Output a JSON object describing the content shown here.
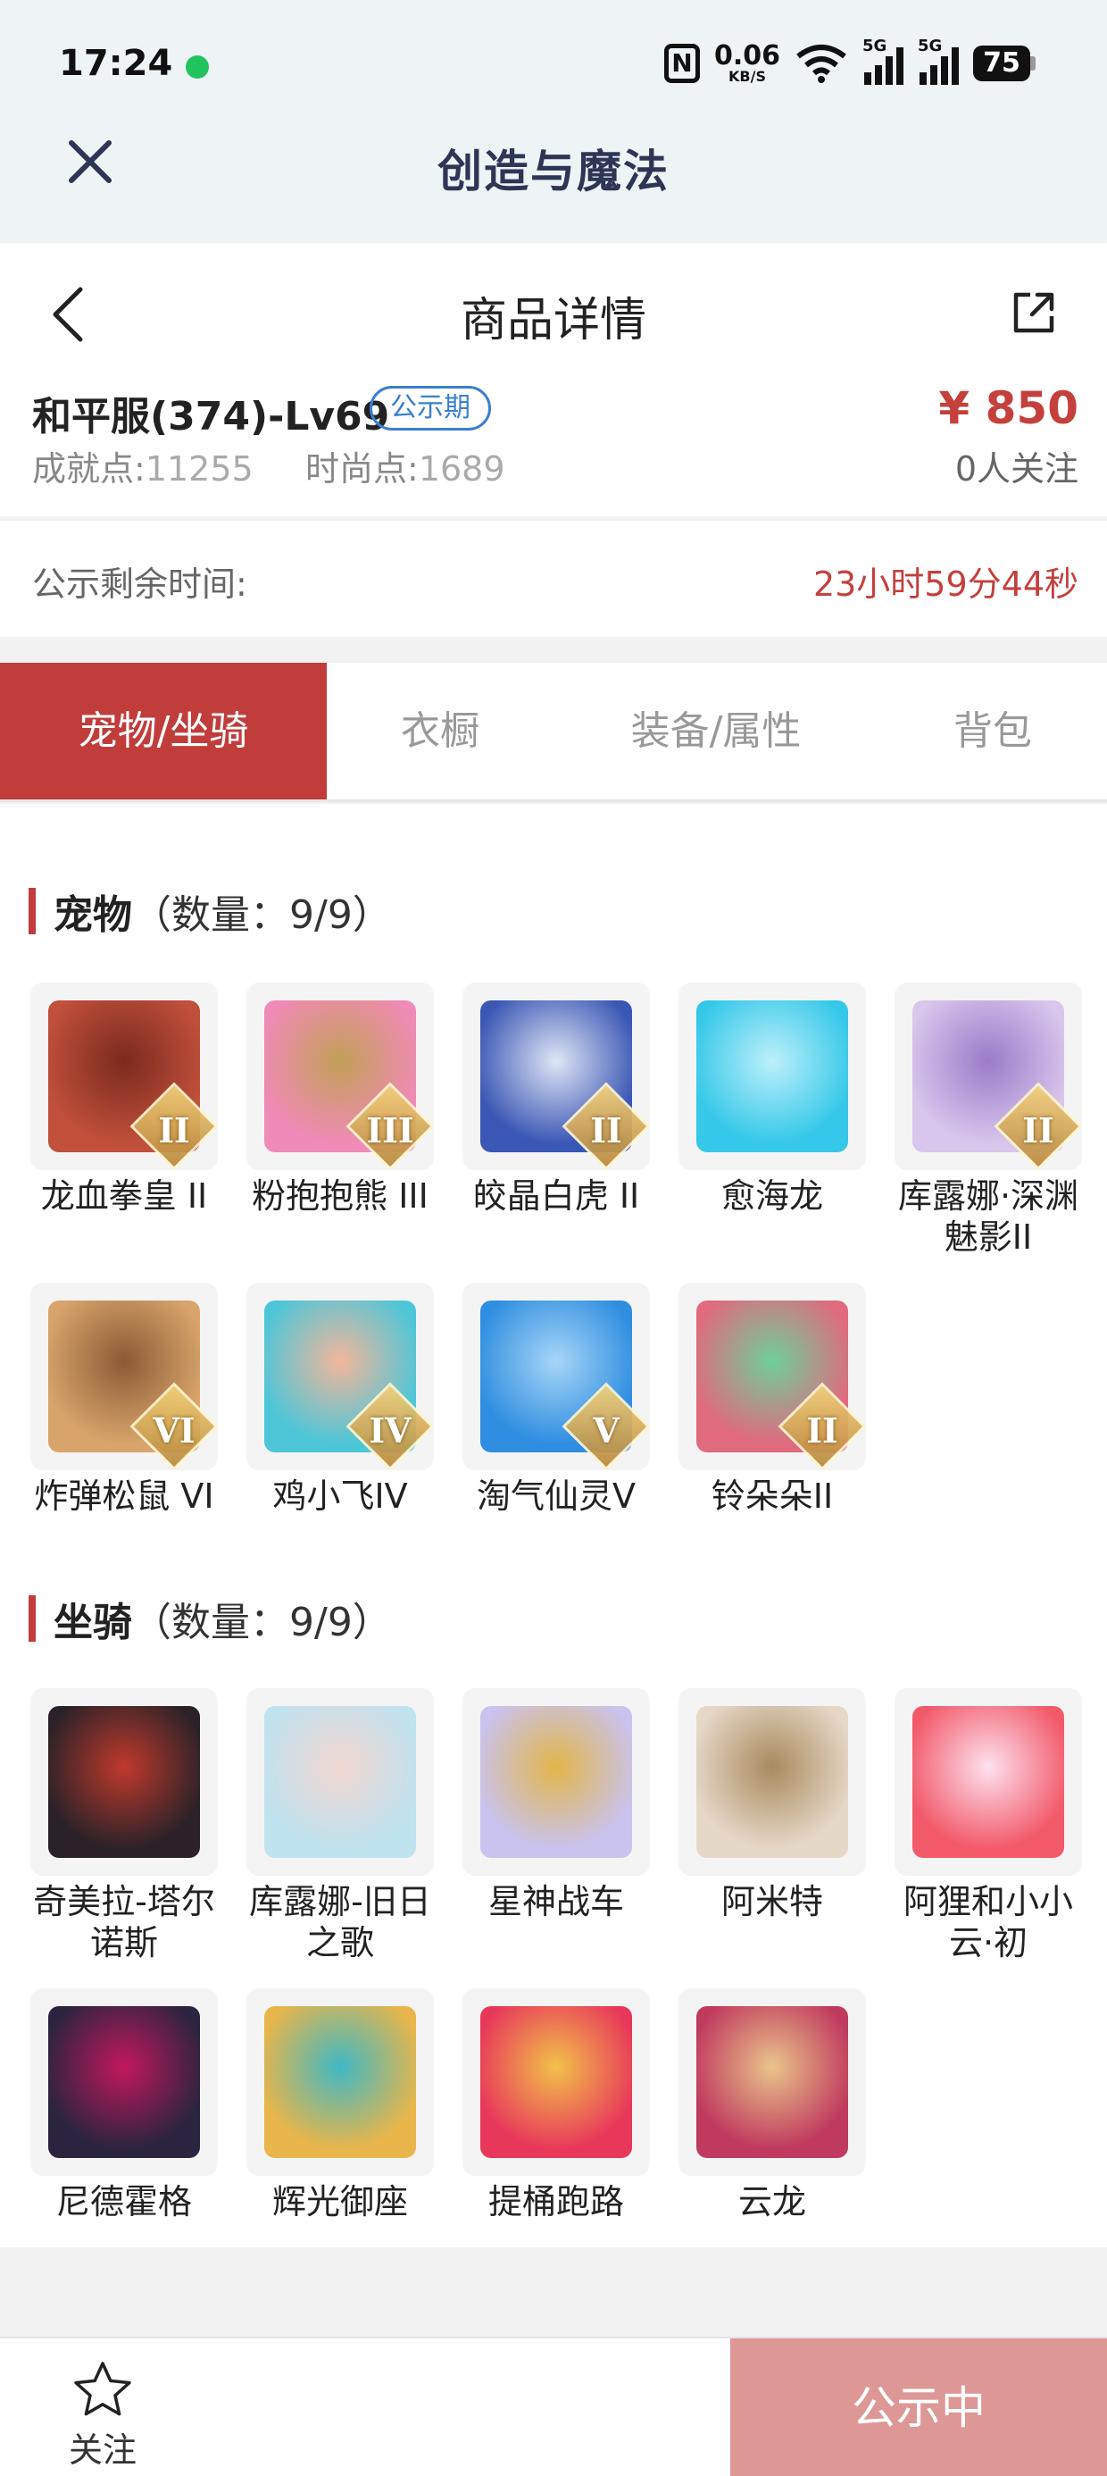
{
  "status_bar": {
    "time": "17:24",
    "speed_value": "0.06",
    "speed_unit": "KB/S",
    "net1": "5G",
    "net2": "5G",
    "battery": "75",
    "message_dot_color": "#22c35e"
  },
  "app": {
    "title": "创造与魔法"
  },
  "detail": {
    "page_title": "商品详情",
    "role_name": "和平服(374)-Lv69",
    "badge": "公示期",
    "price": "¥ 850",
    "achievement_label": "成就点:",
    "achievement_value": "11255",
    "fashion_label": "时尚点:",
    "fashion_value": "1689",
    "followers": "0人关注",
    "accent_color": "#c4403c"
  },
  "publicity": {
    "label": "公示剩余时间:",
    "remaining": "23小时59分44秒"
  },
  "tabs": [
    {
      "label": "宠物/坐骑",
      "active": true
    },
    {
      "label": "衣橱",
      "active": false
    },
    {
      "label": "装备/属性",
      "active": false
    },
    {
      "label": "背包",
      "active": false
    }
  ],
  "pets_section": {
    "title": "宠物",
    "count": "（数量：9/9）",
    "items": [
      {
        "name": "龙血拳皇 II",
        "tier": "II",
        "icon": "red-beast-pet-icon",
        "colors": [
          "#c0503a",
          "#7a2a1e"
        ]
      },
      {
        "name": "粉抱抱熊 III",
        "tier": "III",
        "icon": "pink-bear-pet-icon",
        "colors": [
          "#f08ab6",
          "#c2a057"
        ]
      },
      {
        "name": "皎晶白虎 II",
        "tier": "II",
        "icon": "white-tiger-pet-icon",
        "colors": [
          "#3b57b5",
          "#dfe6f5"
        ]
      },
      {
        "name": "愈海龙",
        "tier": "",
        "icon": "sea-dragon-pet-icon",
        "colors": [
          "#35c8e8",
          "#bdf0fa"
        ]
      },
      {
        "name": "库露娜·深渊魅影II",
        "tier": "II",
        "icon": "kuluna-abyss-pet-icon",
        "colors": [
          "#d8c6ec",
          "#9a7cc8"
        ]
      },
      {
        "name": "炸弹松鼠 VI",
        "tier": "VI",
        "icon": "bomb-squirrel-pet-icon",
        "colors": [
          "#d9a46b",
          "#8a5a34"
        ]
      },
      {
        "name": "鸡小飞IV",
        "tier": "IV",
        "icon": "chick-fly-pet-icon",
        "colors": [
          "#4dc6d8",
          "#f3b69a"
        ]
      },
      {
        "name": "淘气仙灵V",
        "tier": "V",
        "icon": "naughty-fairy-pet-icon",
        "colors": [
          "#2f8ee0",
          "#a6d6f7"
        ]
      },
      {
        "name": "铃朵朵II",
        "tier": "II",
        "icon": "bell-flower-pet-icon",
        "colors": [
          "#e06a7e",
          "#6fcf9a"
        ]
      }
    ]
  },
  "mounts_section": {
    "title": "坐骑",
    "count": "（数量：9/9）",
    "items": [
      {
        "name": "奇美拉-塔尔诺斯",
        "tier": "",
        "icon": "chimera-mount-icon",
        "colors": [
          "#2a2228",
          "#c0392b"
        ]
      },
      {
        "name": "库露娜-旧日之歌",
        "tier": "",
        "icon": "kuluna-song-mount-icon",
        "colors": [
          "#bfe3ef",
          "#f2d6d0"
        ]
      },
      {
        "name": "星神战车",
        "tier": "",
        "icon": "star-chariot-mount-icon",
        "colors": [
          "#c9c3ee",
          "#e2b64a"
        ]
      },
      {
        "name": "阿米特",
        "tier": "",
        "icon": "ammit-mount-icon",
        "colors": [
          "#e6d8c8",
          "#a98a5e"
        ]
      },
      {
        "name": "阿狸和小小云·初",
        "tier": "",
        "icon": "ali-cloud-mount-icon",
        "colors": [
          "#f25a6a",
          "#fde2ee"
        ]
      },
      {
        "name": "尼德霍格",
        "tier": "",
        "icon": "nidhogg-mount-icon",
        "colors": [
          "#2a2440",
          "#c2185b"
        ]
      },
      {
        "name": "辉光御座",
        "tier": "",
        "icon": "radiant-throne-mount-icon",
        "colors": [
          "#e8b64a",
          "#3fb8c4"
        ]
      },
      {
        "name": "提桶跑路",
        "tier": "",
        "icon": "bucket-run-mount-icon",
        "colors": [
          "#e8385a",
          "#f2c14a"
        ]
      },
      {
        "name": "云龙",
        "tier": "",
        "icon": "cloud-dragon-mount-icon",
        "colors": [
          "#c0395e",
          "#e9c58a"
        ]
      }
    ]
  },
  "bottom": {
    "follow_label": "关注",
    "status_label": "公示中"
  }
}
